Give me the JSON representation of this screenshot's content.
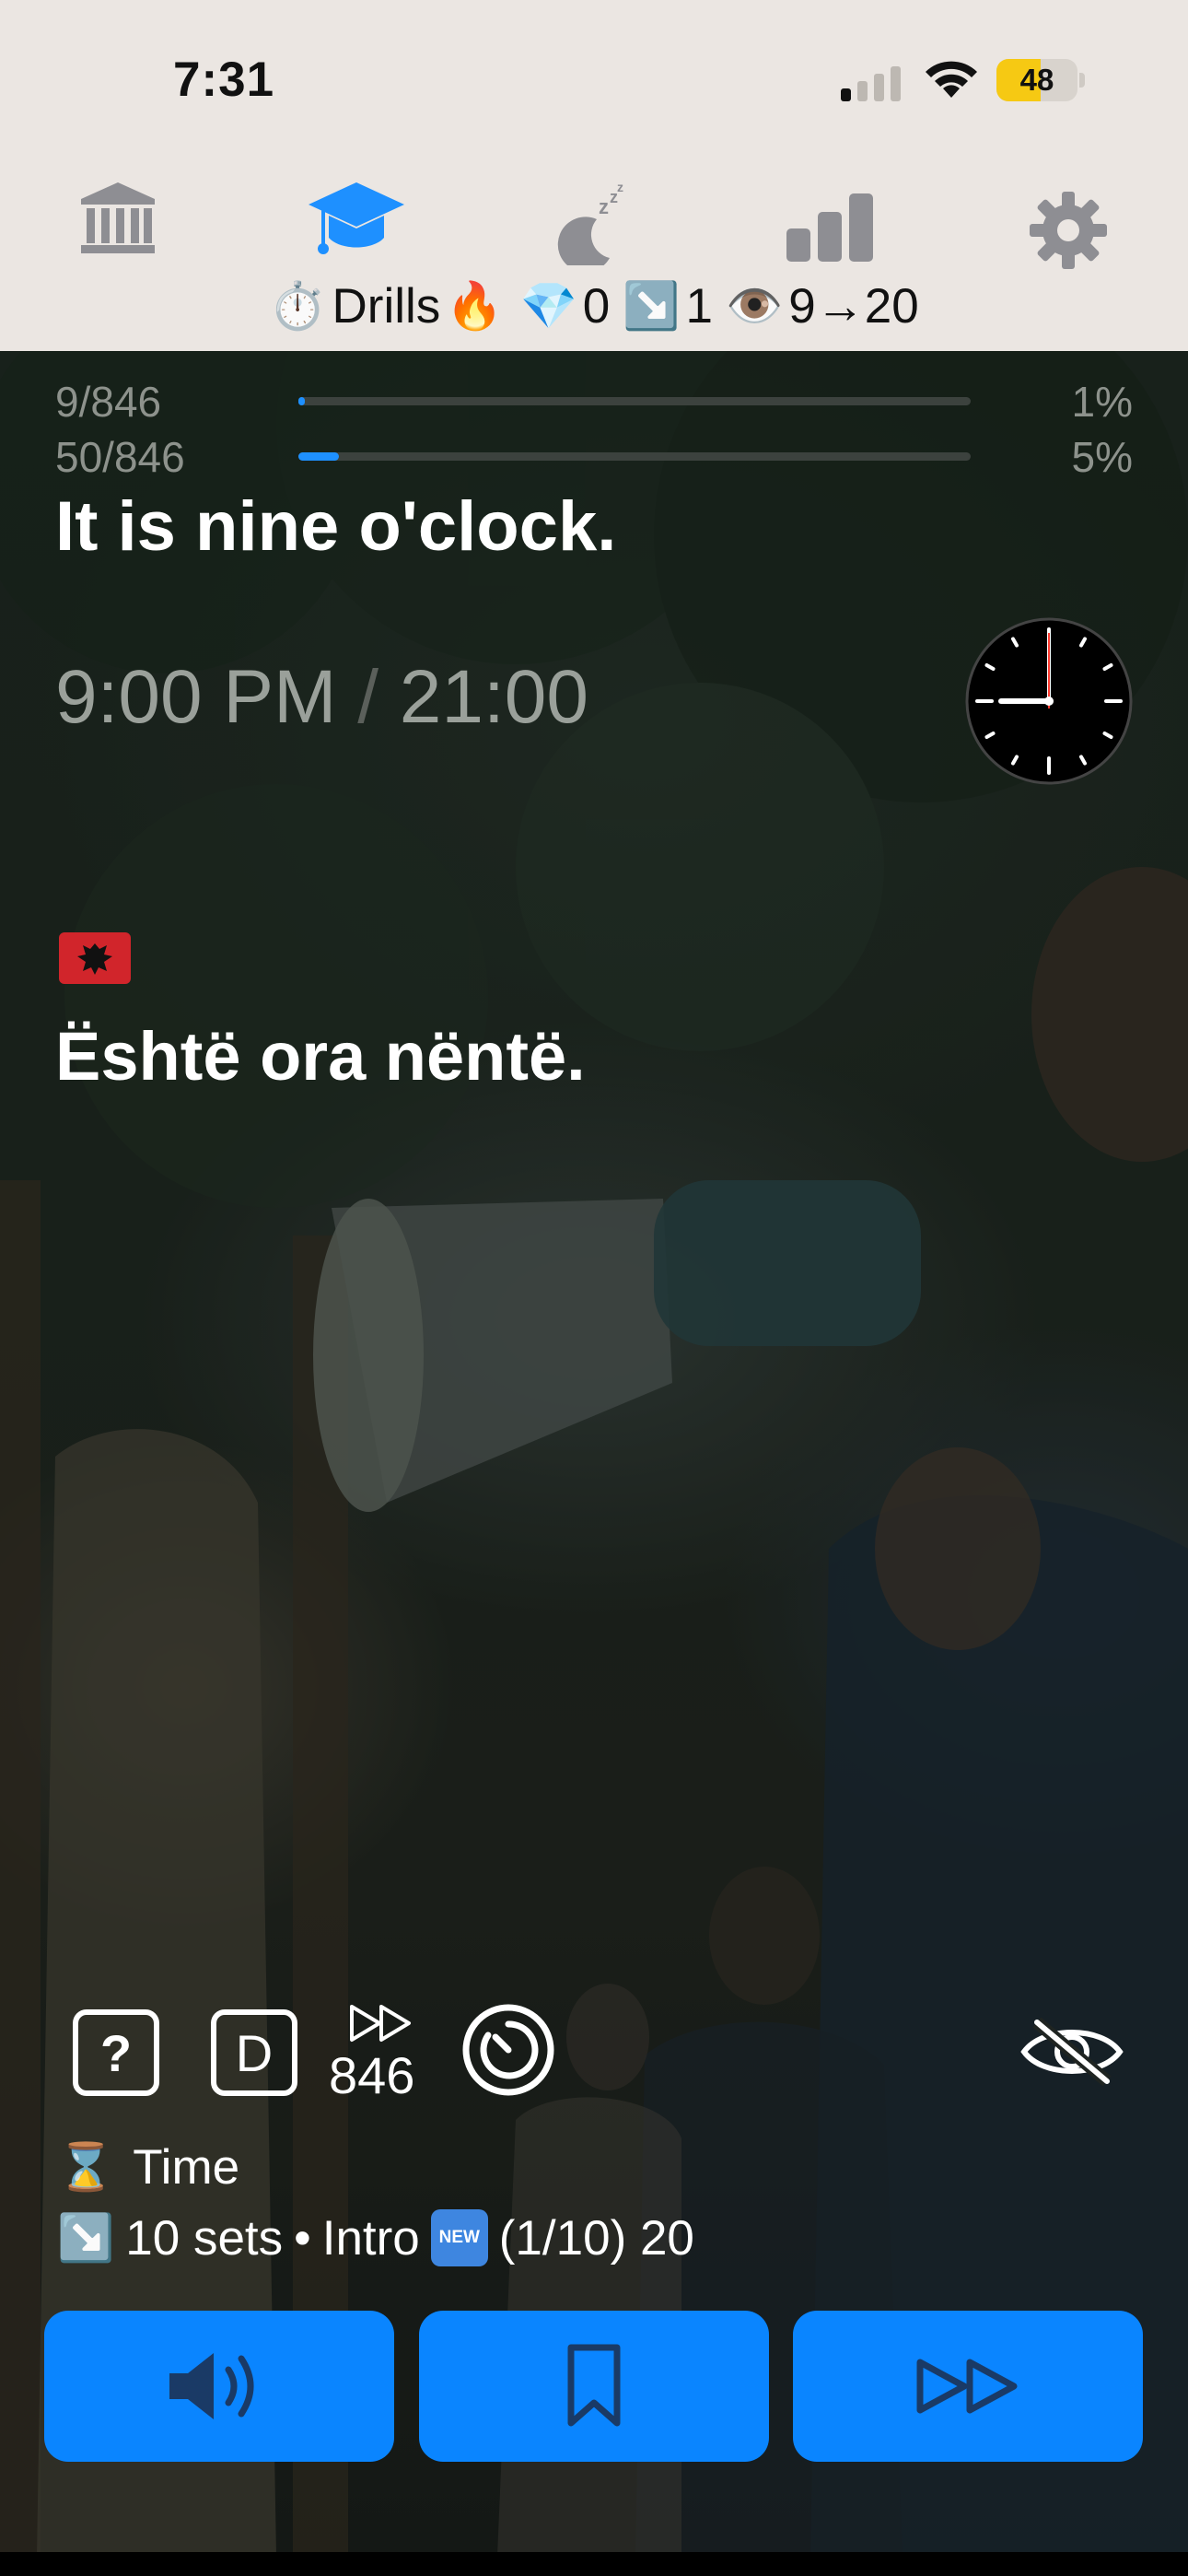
{
  "status_bar": {
    "time": "7:31",
    "battery": "48",
    "battery_level": 0.48
  },
  "tab_bar": {
    "tabs": [
      {
        "name": "library",
        "icon": "bank-icon",
        "active": false
      },
      {
        "name": "learn",
        "icon": "graduation-cap-icon",
        "active": true
      },
      {
        "name": "sleep",
        "icon": "moon-zzz-icon",
        "active": false
      },
      {
        "name": "stats",
        "icon": "bar-chart-icon",
        "active": false
      },
      {
        "name": "settings",
        "icon": "gear-icon",
        "active": false
      }
    ],
    "summary": {
      "mode_label": "Drills",
      "diamonds": "0",
      "arrow_count": "1",
      "views": "9→20"
    }
  },
  "progress": [
    {
      "count": "9/846",
      "percent": "1%",
      "fraction": 0.01
    },
    {
      "count": "50/846",
      "percent": "5%",
      "fraction": 0.06
    }
  ],
  "card": {
    "english": "It is nine o'clock.",
    "time_12h": "9:00 PM",
    "separator": "/",
    "time_24h": "21:00",
    "albanian": "Është ora nëntë."
  },
  "controls": {
    "help_label": "?",
    "difficulty_label": "D",
    "skip_count": "846"
  },
  "info": {
    "category": "Time",
    "sets": "10 sets",
    "dot": "•",
    "intro": "Intro",
    "new_badge": "NEW",
    "new_progress": "(1/10) 20"
  },
  "colors": {
    "accent": "#0a85ff",
    "topbar_bg": "#ebe6e2",
    "active_tab": "#1e90ff",
    "inactive_tab": "#8e8e93"
  }
}
